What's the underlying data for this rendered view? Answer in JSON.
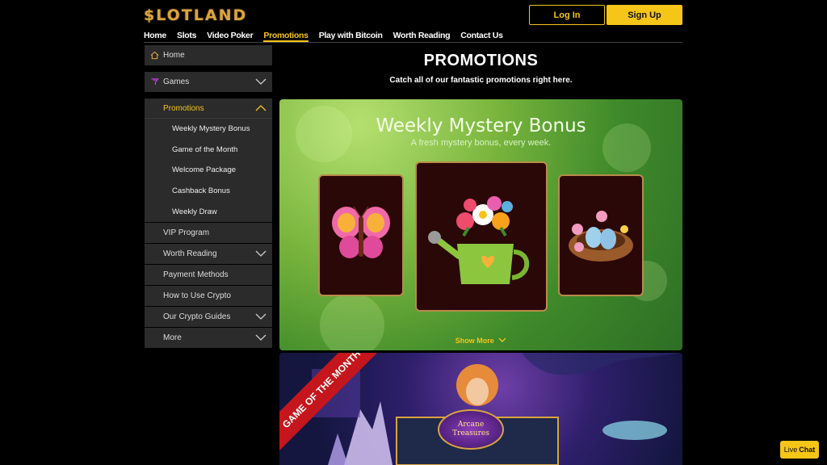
{
  "header": {
    "logo": "$LOTLAND",
    "login_label": "Log In",
    "signup_label": "Sign Up"
  },
  "topnav": {
    "items": [
      "Home",
      "Slots",
      "Video Poker",
      "Promotions",
      "Play with Bitcoin",
      "Worth Reading",
      "Contact Us"
    ],
    "active": "Promotions"
  },
  "sidebar": {
    "home": "Home",
    "games": "Games",
    "promotions": "Promotions",
    "promotions_sub": [
      "Weekly Mystery Bonus",
      "Game of the Month",
      "Welcome Package",
      "Cashback Bonus",
      "Weekly Draw"
    ],
    "items": [
      "VIP Program",
      "Worth Reading",
      "Payment Methods",
      "How to Use Crypto",
      "Our Crypto Guides",
      "More"
    ]
  },
  "main": {
    "title": "PROMOTIONS",
    "subtitle": "Catch all of our fantastic promotions right here.",
    "banner1": {
      "title": "Weekly Mystery Bonus",
      "subtitle": "A fresh mystery bonus, every week.",
      "show_more": "Show More"
    },
    "banner2": {
      "ribbon": "GAME OF THE MONTH",
      "game_logo": "Arcane Treasures"
    }
  },
  "livechat": {
    "label_a": "Live",
    "label_b": "Chat"
  },
  "colors": {
    "accent": "#f5c518",
    "logo": "#d9a441",
    "sidebar_bg": "#2b2b2b",
    "ribbon": "#c4161c"
  }
}
